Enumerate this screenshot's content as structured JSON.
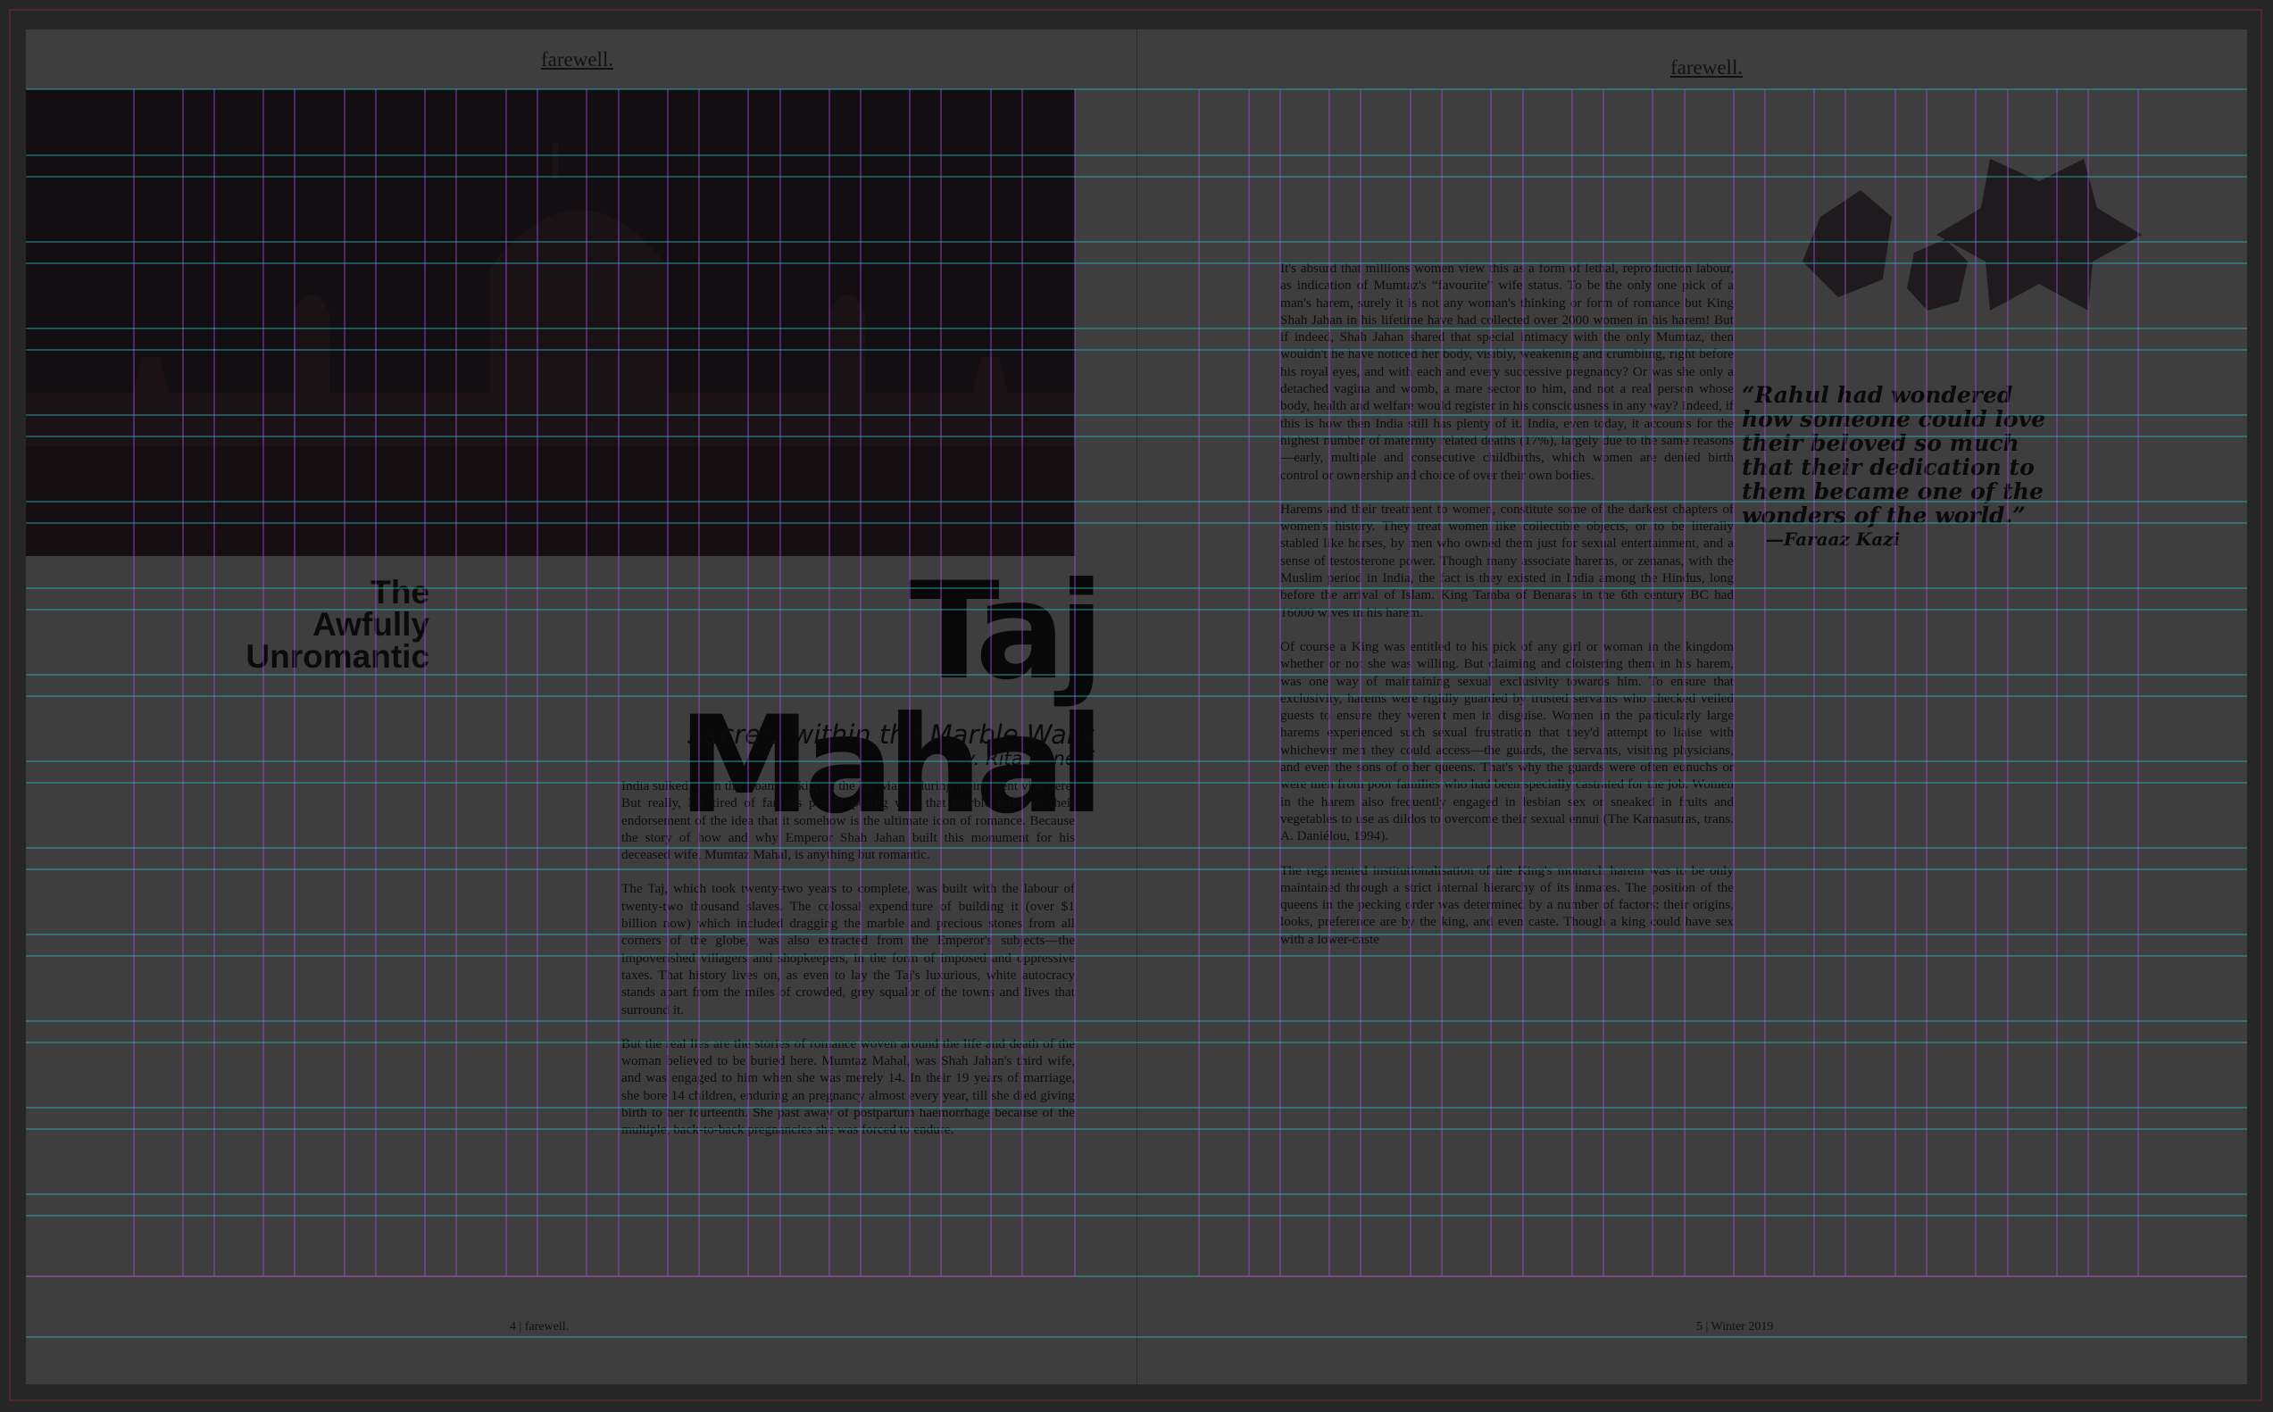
{
  "spread": {
    "left_page": {
      "running_head": "farewell.",
      "folio": "4 | farewell.",
      "kicker_lines": [
        "The",
        "Awfully",
        "Unromantic"
      ],
      "headline": "Taj Mahal",
      "subtitle": "Secrets within the Marble Walls",
      "byline": "By. Rita Banerji",
      "paragraphs": [
        "India sulked when the Obamas skipped the Taj Mahal during their recent visit here. But really, I'm tired of famous people posing with that marble tomb as their endorsement of the idea that it somehow is the ultimate icon of romance. Because the story of how and why Emperor Shah Jahan built this monument for his deceased wife, Mumtaz Mahal, is anything but romantic.",
        "The Taj, which took twenty-two years to complete, was built with the labour of twenty-two thousand slaves. The colossal expenditure of building it (over $1 billion now) which included dragging the marble and precious stones from all corners of the globe, was also extracted from the Emperor's subjects—the impoverished villagers and shopkeepers, in the form of imposed and oppressive taxes. That history lives on, as even to lay the Taj's luxurious, white autocracy stands apart from the miles of crowded, grey squalor of the towns and lives that surround it.",
        "But the real lies are the stories of romance woven around the life and death of the woman believed to be buried here. Mumtaz Mahal, was Shah Jahan's third wife, and was engaged to him when she was merely 14. In their 19 years of marriage, she bore 14 children, enduring an pregnancy almost every year, till she died giving birth to her fourteenth. She past away of postpartum haemorrhage because of the multiple, back-to-back pregnancies she was forced to endure."
      ]
    },
    "right_page": {
      "running_head": "farewell.",
      "folio": "5 | Winter 2019",
      "paragraphs": [
        "It's absurd that millions women view this as a form of lethal, reproduction labour, as indication of Mumtaz's “favourite” wife status. To be the only one pick of a man's harem, surely it is not any woman's thinking or form of romance but King Shah Jahan in his lifetime have had collected over 2000 women in his harem! But if indeed, Shah Jahan shared that special intimacy with the only Mumtaz, then wouldn't he have noticed her body, visibly, weakening and crumbling, right before his royal eyes, and with each and every successive pregnancy? Or was she only a detached vagina and womb, a mare sector to him, and not a real person whose body, health and welfare would register in his consciousness in any way? Indeed, if this is how then India still has plenty of it. India, even today, it accounts for the highest number of maternity related deaths (17%), largely due to the same reasons—early, multiple and consecutive childbirths, which women are denied birth control or ownership and choice of over their own bodies.",
        "Harems and their treatment to women, constitute some of the darkest chapters of women's history. They treat women like collectible objects, or to be literally stabled like horses, by men who owned them just for sexual entertainment, and a sense of testosterone power. Though many associate harems, or zenanas, with the Muslim period in India, the fact is they existed in India among the Hindus, long before the arrival of Islam. King Tamba of Benaras in the 6th century BC had 16000 wives in his harem.",
        "Of course a King was entitled to his pick of any girl or woman in the kingdom whether or not she was willing. But claiming and cloistering them in his harem, was one way of maintaining sexual exclusivity towards him. To ensure that exclusivity, harems were rigidly guarded by trusted servants who checked veiled guests to ensure they weren't men in disguise. Women in the particularly large harems experienced such sexual frustration that they'd attempt to liaise with whichever men they could access—the guards, the servants, visiting physicians, and even the sons of other queens. That's why the guards were often eunuchs or were men from poor families who had been specially castrated for the job. Women in the harem also frequently engaged in lesbian sex or sneaked in fruits and vegetables to use as dildos to overcome their sexual ennui (The Kamasutras, trans. A. Daniélou, 1994).",
        "The regimented institutionalisation of the King's monarch harem was to be only maintained through a strict internal hierarchy of its inmates. The position of the queens in the pecking order was determined by a number of factors: their origins, looks, preference are by the king, and even caste. Though a king could have sex with a lower-caste"
      ],
      "pullquote": "“Rahul had wondered how someone could love their beloved so much that their dedication to them became one of the wonders of the world.”",
      "pullquote_attribution": "—Faraaz Kazi"
    }
  },
  "colors": {
    "workspace": "#262626",
    "paper": "#3e3e3e",
    "column_guide": "#9b4ed6",
    "baseline_guide": "#2bb5b8",
    "margin_guide": "#c14fc8",
    "frame": "#4d2929"
  },
  "icons": [
    "hexagon-shape",
    "hexagon-shape-small",
    "star-shape"
  ]
}
